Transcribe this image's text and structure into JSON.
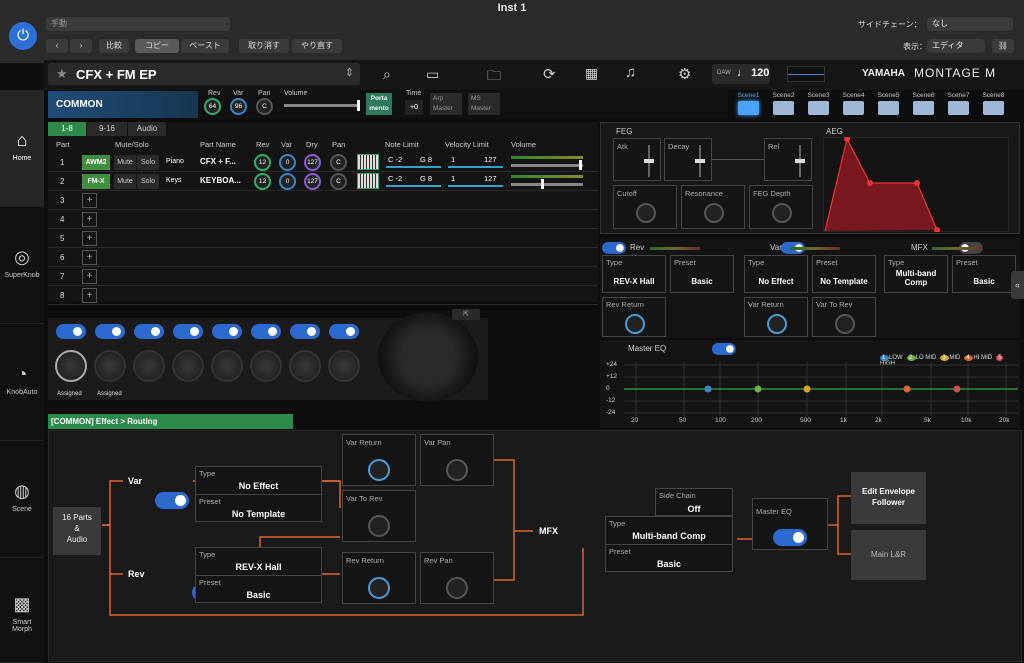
{
  "window": {
    "title": "Inst 1"
  },
  "mac": {
    "preset": "手動",
    "compare": "比較",
    "copy": "コピー",
    "paste": "ペースト",
    "undo": "取り消す",
    "redo": "やり直す",
    "sidechain_label": "サイドチェーン：",
    "sidechain_value": "なし",
    "view_label": "表示：",
    "view_value": "エディタ"
  },
  "header": {
    "perf_name": "CFX + FM EP",
    "daw": "DAW",
    "tempo": "120",
    "brand1": "YAMAHA",
    "brand2": "MONTAGE M"
  },
  "common": {
    "title": "COMMON",
    "rev_label": "Rev",
    "rev_val": "64",
    "var_label": "Var",
    "var_val": "96",
    "pan_label": "Pan",
    "pan_val": "C",
    "volume_label": "Volume",
    "porta_label": "Porta\nmento",
    "time_label": "Time",
    "time_val": "+0",
    "arp_label": "Arp\nMaster",
    "ms_label": "MS\nMaster"
  },
  "scenes": [
    "Scene1",
    "Scene2",
    "Scene3",
    "Scene4",
    "Scene5",
    "Scene6",
    "Scene7",
    "Scene8"
  ],
  "tabs": [
    "1-8",
    "9-16",
    "Audio"
  ],
  "cols": {
    "part": "Part",
    "mute_solo": "Mute/Solo",
    "part_name": "Part Name",
    "rev": "Rev",
    "var": "Var",
    "dry": "Dry",
    "pan": "Pan",
    "note": "Note Limit",
    "vel": "Velocity Limit",
    "vol": "Volume"
  },
  "parts": [
    {
      "num": "1",
      "engine": "AWM2",
      "mute": "Mute",
      "solo": "Solo",
      "cat": "Piano",
      "name": "CFX + F...",
      "rev": "12",
      "var": "0",
      "dry": "127",
      "pan": "C",
      "note_lo": "C -2",
      "note_hi": "G 8",
      "vel_lo": "1",
      "vel_hi": "127"
    },
    {
      "num": "2",
      "engine": "FM-X",
      "mute": "Mute",
      "solo": "Solo",
      "cat": "Keys",
      "name": "KEYBOA...",
      "rev": "12",
      "var": "0",
      "dry": "127",
      "pan": "C",
      "note_lo": "C -2",
      "note_hi": "G 8",
      "vel_lo": "1",
      "vel_hi": "127"
    }
  ],
  "empty_parts": [
    "3",
    "4",
    "5",
    "6",
    "7",
    "8"
  ],
  "knobs": {
    "assigned": "Assigned"
  },
  "feg": {
    "title": "FEG",
    "atk": "Atk",
    "decay": "Decay",
    "rel": "Rel",
    "cutoff": "Cutoff",
    "resonance": "Resonance",
    "depth": "FEG Depth"
  },
  "aeg": {
    "title": "AEG"
  },
  "fx": {
    "rev": "Rev",
    "var": "Var",
    "mfx": "MFX",
    "type": "Type",
    "preset": "Preset",
    "rev_type": "REV-X Hall",
    "rev_preset": "Basic",
    "var_type": "No Effect",
    "var_preset": "No Template",
    "mfx_type": "Multi-band Comp",
    "mfx_preset": "Basic",
    "rev_return": "Rev Return",
    "var_return": "Var Return",
    "var_to_rev": "Var To Rev"
  },
  "eq": {
    "title": "Master EQ",
    "legend": [
      "LOW",
      "LO MID",
      "MID",
      "HI MID",
      "HIGH"
    ],
    "y": [
      "+24",
      "+12",
      "0",
      "-12",
      "-24"
    ],
    "x": [
      "20",
      "50",
      "100",
      "200",
      "500",
      "1k",
      "2k",
      "5k",
      "10k",
      "20k"
    ]
  },
  "routing": {
    "title": "[COMMON] Effect > Routing",
    "src": "16 Parts\n&\nAudio",
    "var": "Var",
    "rev": "Rev",
    "type": "Type",
    "preset": "Preset",
    "var_type": "No Effect",
    "var_preset": "No Template",
    "rev_type": "REV-X Hall",
    "rev_preset": "Basic",
    "var_return": "Var Return",
    "var_pan": "Var Pan",
    "var_to_rev": "Var To Rev",
    "rev_return": "Rev Return",
    "rev_pan": "Rev Pan",
    "mfx": "MFX",
    "side_chain": "Side Chain",
    "side_chain_val": "Off",
    "mfx_type": "Multi-band Comp",
    "mfx_preset": "Basic",
    "master_eq": "Master EQ",
    "env_follower": "Edit Envelope\nFollower",
    "main": "Main L&R"
  },
  "sidebar": [
    "Home",
    "SuperKnob",
    "KnobAuto",
    "Scene",
    "Smart\nMorph"
  ]
}
